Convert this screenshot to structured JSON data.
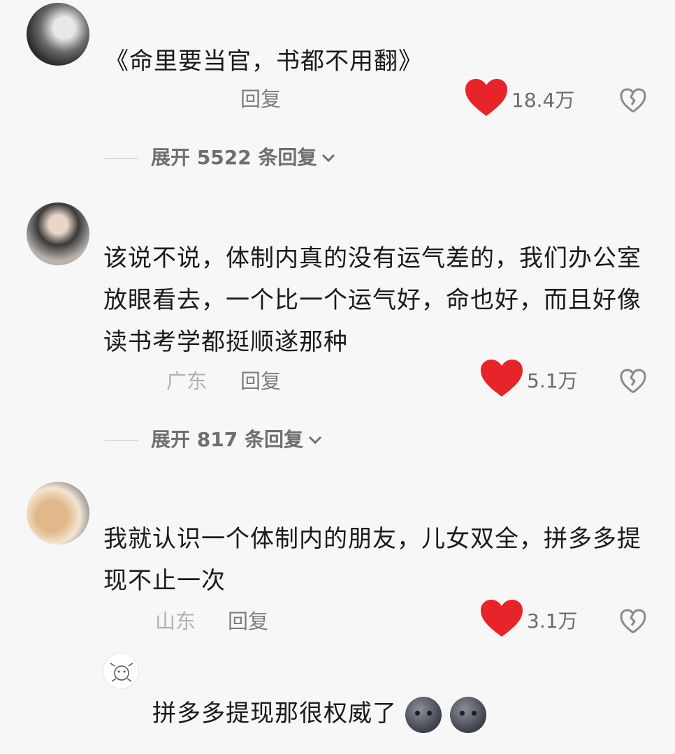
{
  "comments": [
    {
      "text": "《命里要当官，书都不用翻》",
      "reply_label": "回复",
      "likes": "18.4万",
      "expand_label": "展开 5522 条回复"
    },
    {
      "text": "该说不说，体制内真的没有运气差的，我们办公室放眼看去，一个比一个运气好，命也好，而且好像读书考学都挺顺遂那种",
      "location": "广东",
      "reply_label": "回复",
      "likes": "5.1万",
      "expand_label": "展开 817 条回复"
    },
    {
      "text": "我就认识一个体制内的朋友，儿女双全，拼多多提现不止一次",
      "location": "山东",
      "reply_label": "回复",
      "likes": "3.1万"
    },
    {
      "text": "拼多多提现那很权威了"
    }
  ],
  "icons": {
    "like": "red-heart-icon",
    "dislike": "broken-heart-icon",
    "expand": "chevron-down-icon",
    "emoji": "face-emoji-icon"
  },
  "colors": {
    "heart": "#e8242b"
  }
}
